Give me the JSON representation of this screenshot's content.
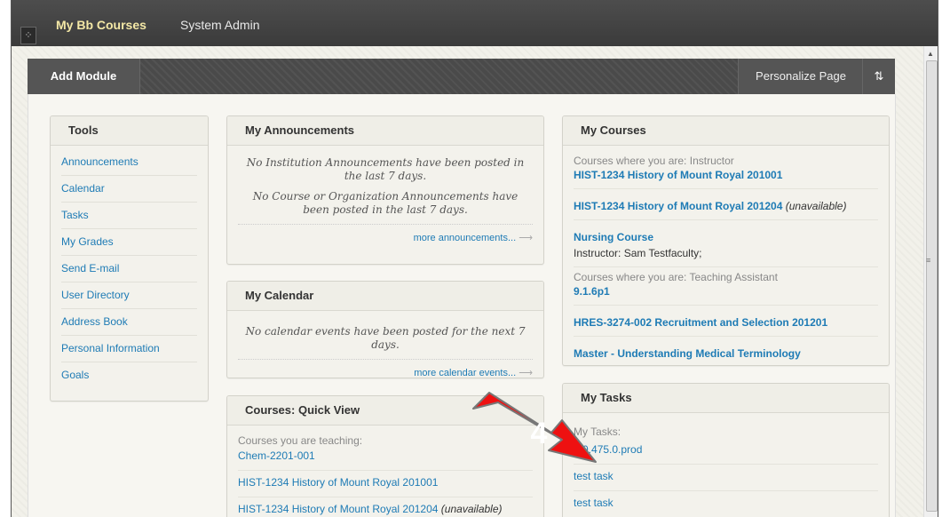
{
  "nav": {
    "tab_courses": "My Bb Courses",
    "tab_admin": "System Admin"
  },
  "toolbar": {
    "add_module": "Add Module",
    "personalize": "Personalize Page",
    "sort_symbol": "⇅"
  },
  "tools": {
    "title": "Tools",
    "items": [
      "Announcements",
      "Calendar",
      "Tasks",
      "My Grades",
      "Send E-mail",
      "User Directory",
      "Address Book",
      "Personal Information",
      "Goals"
    ]
  },
  "announcements": {
    "title": "My Announcements",
    "institution_text": "No Institution Announcements have been posted in the last 7 days.",
    "course_text": "No Course or Organization Announcements have been posted in the last 7 days.",
    "more": "more announcements..."
  },
  "calendar": {
    "title": "My Calendar",
    "text": "No calendar events have been posted for the next 7 days.",
    "more": "more calendar events..."
  },
  "quickview": {
    "title": "Courses: Quick View",
    "label": "Courses you are teaching:",
    "courses": [
      {
        "name": "Chem-2201-001",
        "status": ""
      },
      {
        "name": "HIST-1234 History of Mount Royal 201001",
        "status": ""
      },
      {
        "name": "HIST-1234 History of Mount Royal 201204",
        "status": "(unavailable)"
      }
    ]
  },
  "mycourses": {
    "title": "My Courses",
    "instructor_label": "Courses where you are: Instructor",
    "c1": "HIST-1234 History of Mount Royal 201001",
    "c2": "HIST-1234 History of Mount Royal 201204",
    "c2_status": "(unavailable)",
    "c3": "Nursing Course",
    "c3_instructor_label": "Instructor:",
    "c3_instructor": "Sam Testfaculty;",
    "ta_label": "Courses where you are: Teaching Assistant",
    "c4": "9.1.6p1",
    "c5": "HRES-3274-002 Recruitment and Selection 201201",
    "c6": "Master - Understanding Medical Terminology"
  },
  "tasks": {
    "title": "My Tasks",
    "label": "My Tasks:",
    "items": [
      "9.0.475.0.prod",
      "test task",
      "test task"
    ]
  },
  "annotation": {
    "step_number": "4",
    "color": "#ee1111"
  }
}
